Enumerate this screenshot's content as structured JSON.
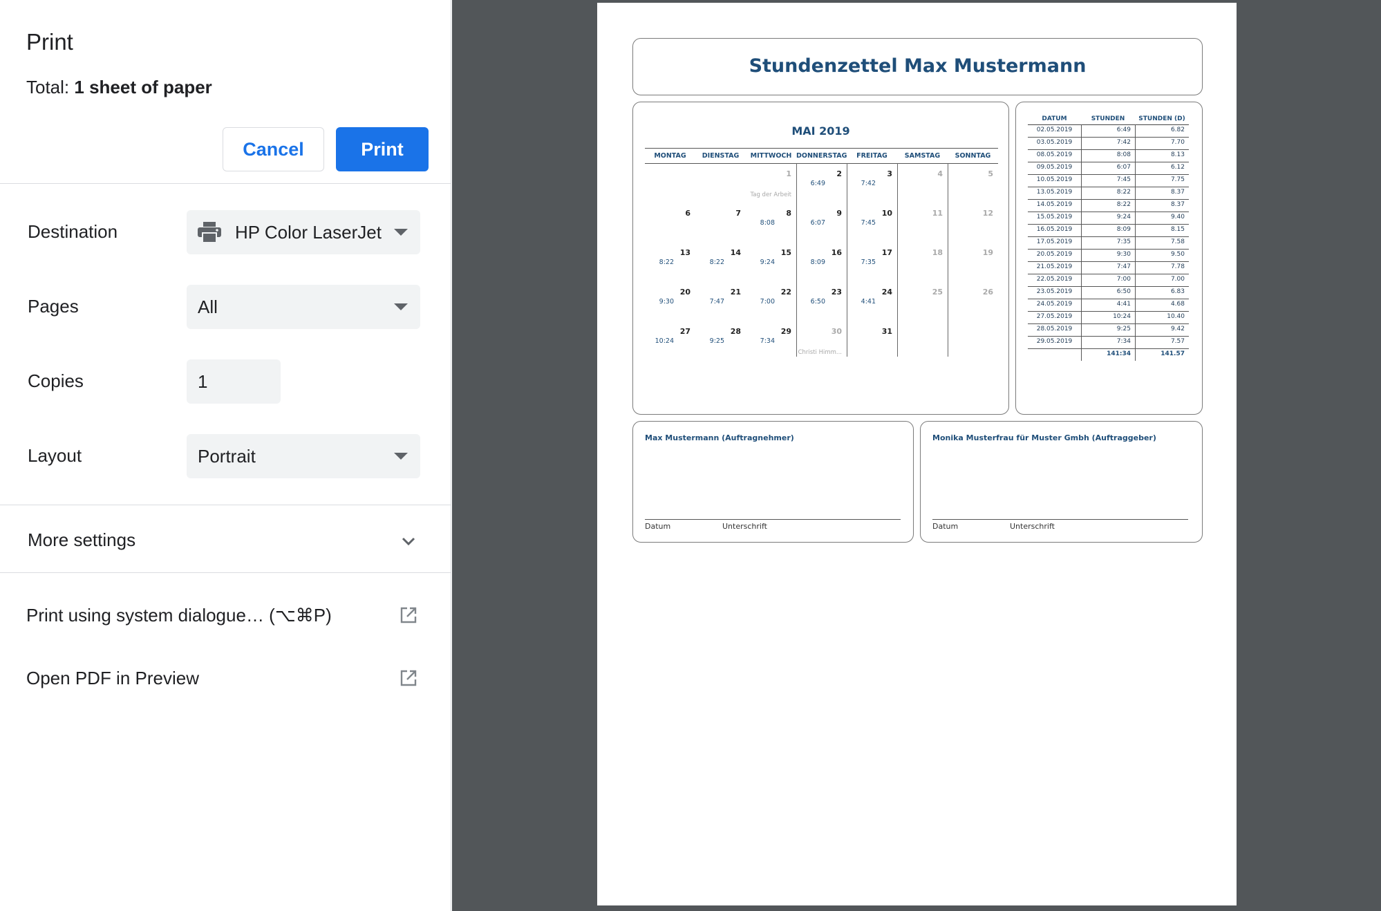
{
  "dialog": {
    "title": "Print",
    "total_label": "Total:",
    "total_value": "1 sheet of paper",
    "cancel_label": "Cancel",
    "print_label": "Print",
    "destination_label": "Destination",
    "destination_value": "HP Color LaserJet",
    "pages_label": "Pages",
    "pages_value": "All",
    "copies_label": "Copies",
    "copies_value": "1",
    "layout_label": "Layout",
    "layout_value": "Portrait",
    "more_settings_label": "More settings",
    "system_dialog_label": "Print using system dialogue… (⌥⌘P)",
    "open_pdf_label": "Open PDF in Preview"
  },
  "document": {
    "title": "Stundenzettel Max Mustermann",
    "calendar": {
      "month_title": "MAI 2019",
      "weekdays": [
        "MONTAG",
        "DIENSTAG",
        "MITTWOCH",
        "DONNERSTAG",
        "FREITAG",
        "SAMSTAG",
        "SONNTAG"
      ],
      "weeks": [
        [
          {
            "d": "",
            "t": "",
            "n": ""
          },
          {
            "d": "",
            "t": "",
            "n": ""
          },
          {
            "d": "1",
            "t": "",
            "n": "Tag der Arbeit",
            "muted": true
          },
          {
            "d": "2",
            "t": "6:49",
            "n": ""
          },
          {
            "d": "3",
            "t": "7:42",
            "n": ""
          },
          {
            "d": "4",
            "t": "",
            "n": "",
            "muted": true
          },
          {
            "d": "5",
            "t": "",
            "n": "",
            "muted": true
          }
        ],
        [
          {
            "d": "6",
            "t": "",
            "n": ""
          },
          {
            "d": "7",
            "t": "",
            "n": ""
          },
          {
            "d": "8",
            "t": "8:08",
            "n": ""
          },
          {
            "d": "9",
            "t": "6:07",
            "n": ""
          },
          {
            "d": "10",
            "t": "7:45",
            "n": ""
          },
          {
            "d": "11",
            "t": "",
            "n": "",
            "muted": true
          },
          {
            "d": "12",
            "t": "",
            "n": "",
            "muted": true
          }
        ],
        [
          {
            "d": "13",
            "t": "8:22",
            "n": ""
          },
          {
            "d": "14",
            "t": "8:22",
            "n": ""
          },
          {
            "d": "15",
            "t": "9:24",
            "n": ""
          },
          {
            "d": "16",
            "t": "8:09",
            "n": ""
          },
          {
            "d": "17",
            "t": "7:35",
            "n": ""
          },
          {
            "d": "18",
            "t": "",
            "n": "",
            "muted": true
          },
          {
            "d": "19",
            "t": "",
            "n": "",
            "muted": true
          }
        ],
        [
          {
            "d": "20",
            "t": "9:30",
            "n": ""
          },
          {
            "d": "21",
            "t": "7:47",
            "n": ""
          },
          {
            "d": "22",
            "t": "7:00",
            "n": ""
          },
          {
            "d": "23",
            "t": "6:50",
            "n": ""
          },
          {
            "d": "24",
            "t": "4:41",
            "n": ""
          },
          {
            "d": "25",
            "t": "",
            "n": "",
            "muted": true
          },
          {
            "d": "26",
            "t": "",
            "n": "",
            "muted": true
          }
        ],
        [
          {
            "d": "27",
            "t": "10:24",
            "n": ""
          },
          {
            "d": "28",
            "t": "9:25",
            "n": ""
          },
          {
            "d": "29",
            "t": "7:34",
            "n": ""
          },
          {
            "d": "30",
            "t": "",
            "n": "Christi Himm...",
            "muted": true
          },
          {
            "d": "31",
            "t": "",
            "n": ""
          },
          {
            "d": "",
            "t": "",
            "n": ""
          },
          {
            "d": "",
            "t": "",
            "n": ""
          }
        ]
      ]
    },
    "hours_table": {
      "headers": [
        "DATUM",
        "STUNDEN",
        "STUNDEN (D)"
      ],
      "rows": [
        [
          "02.05.2019",
          "6:49",
          "6.82"
        ],
        [
          "03.05.2019",
          "7:42",
          "7.70"
        ],
        [
          "08.05.2019",
          "8:08",
          "8.13"
        ],
        [
          "09.05.2019",
          "6:07",
          "6.12"
        ],
        [
          "10.05.2019",
          "7:45",
          "7.75"
        ],
        [
          "13.05.2019",
          "8:22",
          "8.37"
        ],
        [
          "14.05.2019",
          "8:22",
          "8.37"
        ],
        [
          "15.05.2019",
          "9:24",
          "9.40"
        ],
        [
          "16.05.2019",
          "8:09",
          "8.15"
        ],
        [
          "17.05.2019",
          "7:35",
          "7.58"
        ],
        [
          "20.05.2019",
          "9:30",
          "9.50"
        ],
        [
          "21.05.2019",
          "7:47",
          "7.78"
        ],
        [
          "22.05.2019",
          "7:00",
          "7.00"
        ],
        [
          "23.05.2019",
          "6:50",
          "6.83"
        ],
        [
          "24.05.2019",
          "4:41",
          "4.68"
        ],
        [
          "27.05.2019",
          "10:24",
          "10.40"
        ],
        [
          "28.05.2019",
          "9:25",
          "9.42"
        ],
        [
          "29.05.2019",
          "7:34",
          "7.57"
        ]
      ],
      "total_hours": "141:34",
      "total_decimal": "141.57"
    },
    "signatures": [
      {
        "title": "Max Mustermann (Auftragnehmer)",
        "date_label": "Datum",
        "sign_label": "Unterschrift"
      },
      {
        "title": "Monika Musterfrau für Muster Gmbh (Auftraggeber)",
        "date_label": "Datum",
        "sign_label": "Unterschrift"
      }
    ]
  },
  "colors": {
    "accent": "#1a73e8",
    "doc_blue": "#1f4e79",
    "preview_bg": "#525659"
  }
}
